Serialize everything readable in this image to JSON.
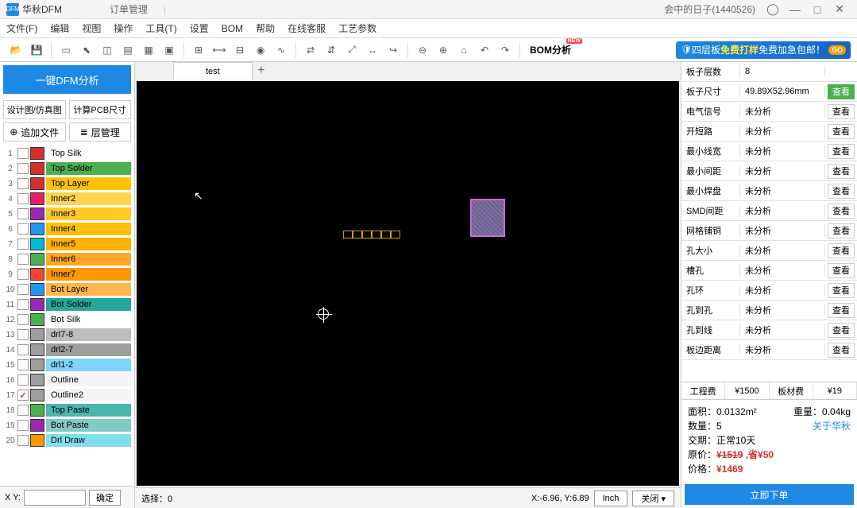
{
  "title": "华秋DFM",
  "tab2": "订单管理",
  "user": "会中的日子(1440526)",
  "menu": [
    "文件(F)",
    "编辑",
    "视图",
    "操作",
    "工具(T)",
    "设置",
    "BOM",
    "帮助",
    "在线客服",
    "工艺参数"
  ],
  "bom_btn": "BOM分析",
  "new_badge": "NEW",
  "promo": {
    "p1": "四层板",
    "p2": "免费打样",
    "p3": " 免费加急包邮！",
    "go": "GO"
  },
  "analyze": "一键DFM分析",
  "left_btns": [
    "设计图/仿真图",
    "计算PCB尺寸"
  ],
  "left_btns2": [
    "追加文件",
    "层管理"
  ],
  "layers": [
    {
      "idx": 1,
      "color": "#d32f2f",
      "bg": "#fff",
      "name": "Top Silk",
      "chk": false
    },
    {
      "idx": 2,
      "color": "#d32f2f",
      "bg": "#4caf50",
      "name": "Top Solder",
      "chk": false
    },
    {
      "idx": 3,
      "color": "#d32f2f",
      "bg": "#ffc107",
      "name": "Top Layer",
      "chk": false
    },
    {
      "idx": 4,
      "color": "#e91e63",
      "bg": "#ffd54f",
      "name": "Inner2",
      "chk": false
    },
    {
      "idx": 5,
      "color": "#9c27b0",
      "bg": "#ffca28",
      "name": "Inner3",
      "chk": false
    },
    {
      "idx": 6,
      "color": "#2196f3",
      "bg": "#ffc107",
      "name": "Inner4",
      "chk": false
    },
    {
      "idx": 7,
      "color": "#00bcd4",
      "bg": "#ffb300",
      "name": "Inner5",
      "chk": false
    },
    {
      "idx": 8,
      "color": "#4caf50",
      "bg": "#ffa726",
      "name": "Inner6",
      "chk": false
    },
    {
      "idx": 9,
      "color": "#f44336",
      "bg": "#ff9800",
      "name": "Inner7",
      "chk": false
    },
    {
      "idx": 10,
      "color": "#2196f3",
      "bg": "#ffb74d",
      "name": "Bot Layer",
      "chk": false
    },
    {
      "idx": 11,
      "color": "#9c27b0",
      "bg": "#26a69a",
      "name": "Bot Solder",
      "chk": false
    },
    {
      "idx": 12,
      "color": "#4caf50",
      "bg": "#fff",
      "name": "Bot Silk",
      "chk": false
    },
    {
      "idx": 13,
      "color": "#9e9e9e",
      "bg": "#bdbdbd",
      "name": "drl7-8",
      "chk": false
    },
    {
      "idx": 14,
      "color": "#9e9e9e",
      "bg": "#9e9e9e",
      "name": "drl2-7",
      "chk": false
    },
    {
      "idx": 15,
      "color": "#9e9e9e",
      "bg": "#81d4fa",
      "name": "drl1-2",
      "chk": false
    },
    {
      "idx": 16,
      "color": "#9e9e9e",
      "bg": "#f5f5f5",
      "name": "Outline",
      "chk": false
    },
    {
      "idx": 17,
      "color": "#9e9e9e",
      "bg": "#f5f5f5",
      "name": "Outline2",
      "chk": true
    },
    {
      "idx": 18,
      "color": "#4caf50",
      "bg": "#4db6ac",
      "name": "Top Paste",
      "chk": false
    },
    {
      "idx": 19,
      "color": "#9c27b0",
      "bg": "#80cbc4",
      "name": "Bot Paste",
      "chk": false
    },
    {
      "idx": 20,
      "color": "#ff9800",
      "bg": "#80deea",
      "name": "Drl Draw",
      "chk": false
    }
  ],
  "xy_label": "X Y:",
  "xy_confirm": "确定",
  "tab_name": "test",
  "status": {
    "select": "选择：",
    "select_val": "0",
    "coords": "X:-6.96, Y:6.89",
    "inch": "Inch",
    "close": "关闭 ▾"
  },
  "analysis": [
    {
      "label": "板子层数",
      "value": "8",
      "btn": ""
    },
    {
      "label": "板子尺寸",
      "value": "49.89X52.96mm",
      "btn": "查看",
      "green": true
    },
    {
      "label": "电气信号",
      "value": "未分析",
      "btn": "查看"
    },
    {
      "label": "开短路",
      "value": "未分析",
      "btn": "查看"
    },
    {
      "label": "最小线宽",
      "value": "未分析",
      "btn": "查看"
    },
    {
      "label": "最小间距",
      "value": "未分析",
      "btn": "查看"
    },
    {
      "label": "最小焊盘",
      "value": "未分析",
      "btn": "查看"
    },
    {
      "label": "SMD间距",
      "value": "未分析",
      "btn": "查看"
    },
    {
      "label": "网格铺铜",
      "value": "未分析",
      "btn": "查看"
    },
    {
      "label": "孔大小",
      "value": "未分析",
      "btn": "查看"
    },
    {
      "label": "槽孔",
      "value": "未分析",
      "btn": "查看"
    },
    {
      "label": "孔环",
      "value": "未分析",
      "btn": "查看"
    },
    {
      "label": "孔到孔",
      "value": "未分析",
      "btn": "查看"
    },
    {
      "label": "孔到线",
      "value": "未分析",
      "btn": "查看"
    },
    {
      "label": "板边距离",
      "value": "未分析",
      "btn": "查看"
    }
  ],
  "cost": {
    "eng_label": "工程费",
    "eng_val": "¥1500",
    "mat_label": "板材费",
    "mat_val": "¥19"
  },
  "summary": {
    "area": "面积：0.0132m²",
    "weight": "重量：0.04kg",
    "qty": "数量：5",
    "link": "关于华秋",
    "delivery": "交期：正常10天",
    "orig_label": "原价：",
    "orig_val": "¥1519",
    "save": " ,省¥50",
    "price_label": "价格：",
    "price_val": "¥1469"
  },
  "order_btn": "立即下单"
}
